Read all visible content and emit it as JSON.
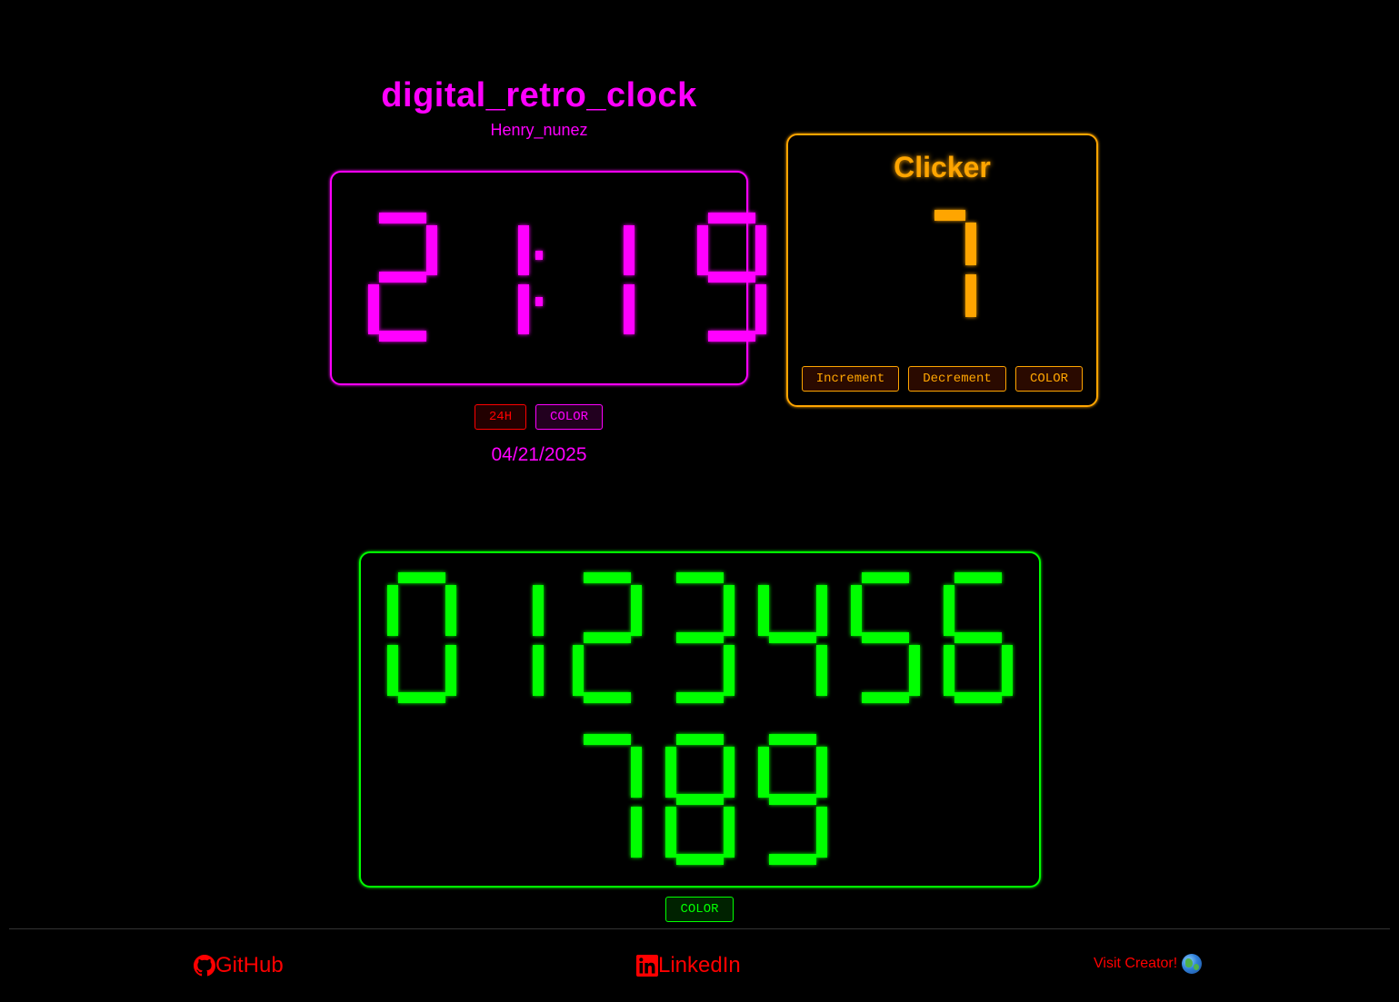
{
  "header": {
    "title": "digital_retro_clock",
    "author": "Henry_nunez"
  },
  "colors": {
    "clock": "#ff00ff",
    "clicker": "#ffa500",
    "digits": "#00ff00",
    "footer": "#ff0000",
    "background": "#000000"
  },
  "clock": {
    "time": "21:19",
    "mode_button_label": "24H",
    "color_button_label": "COLOR",
    "date": "04/21/2025"
  },
  "clicker": {
    "title": "Clicker",
    "count": "7",
    "increment_label": "Increment",
    "decrement_label": "Decrement",
    "color_button_label": "COLOR"
  },
  "digit_showcase": {
    "digits": [
      "0",
      "1",
      "2",
      "3",
      "4",
      "5",
      "6",
      "7",
      "8",
      "9"
    ],
    "color_button_label": "COLOR"
  },
  "footer": {
    "github_label": "GitHub",
    "github_icon": "github-icon",
    "linkedin_label": "LinkedIn",
    "linkedin_icon": "linkedin-icon",
    "visit_label": "Visit Creator!",
    "visit_icon": "globe-icon"
  }
}
